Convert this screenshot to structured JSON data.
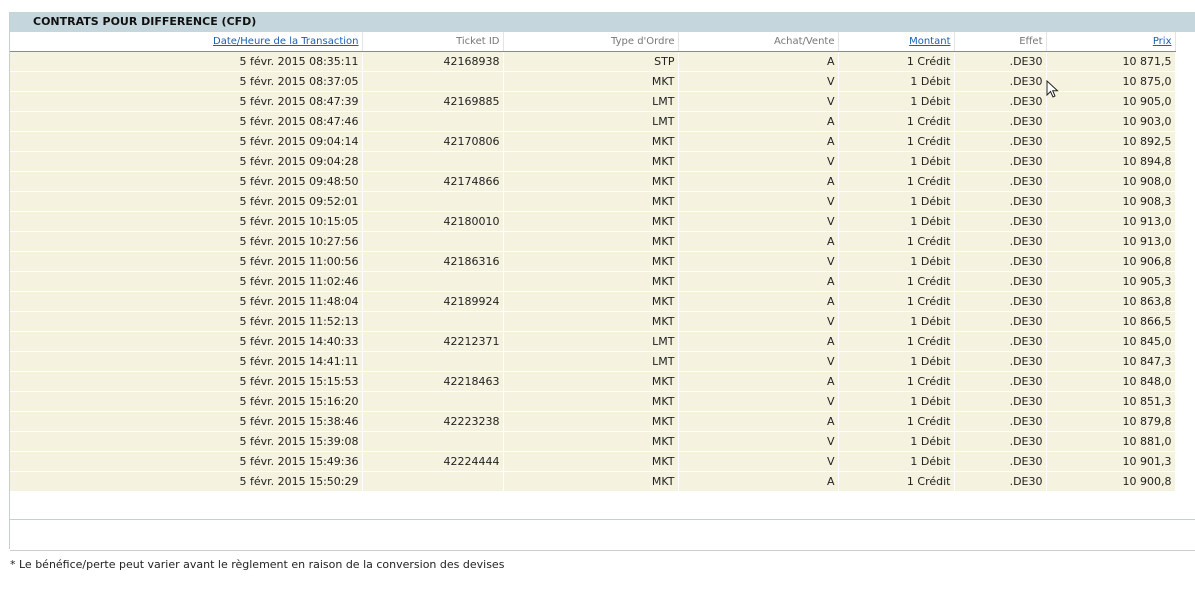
{
  "section": {
    "title": "CONTRATS POUR DIFFERENCE (CFD)"
  },
  "columns": [
    {
      "label": "Date/Heure de la Transaction",
      "sortable": true
    },
    {
      "label": "Ticket ID",
      "sortable": false
    },
    {
      "label": "Type d'Ordre",
      "sortable": false
    },
    {
      "label": "Achat/Vente",
      "sortable": false
    },
    {
      "label": "Montant",
      "sortable": true
    },
    {
      "label": "Effet",
      "sortable": false
    },
    {
      "label": "Prix",
      "sortable": true
    }
  ],
  "rows": [
    [
      "5 févr. 2015 08:35:11",
      "42168938",
      "STP",
      "A",
      "1 Crédit",
      ".DE30",
      "10 871,5"
    ],
    [
      "5 févr. 2015 08:37:05",
      "",
      "MKT",
      "V",
      "1 Débit",
      ".DE30",
      "10 875,0"
    ],
    [
      "5 févr. 2015 08:47:39",
      "42169885",
      "LMT",
      "V",
      "1 Débit",
      ".DE30",
      "10 905,0"
    ],
    [
      "5 févr. 2015 08:47:46",
      "",
      "LMT",
      "A",
      "1 Crédit",
      ".DE30",
      "10 903,0"
    ],
    [
      "5 févr. 2015 09:04:14",
      "42170806",
      "MKT",
      "A",
      "1 Crédit",
      ".DE30",
      "10 892,5"
    ],
    [
      "5 févr. 2015 09:04:28",
      "",
      "MKT",
      "V",
      "1 Débit",
      ".DE30",
      "10 894,8"
    ],
    [
      "5 févr. 2015 09:48:50",
      "42174866",
      "MKT",
      "A",
      "1 Crédit",
      ".DE30",
      "10 908,0"
    ],
    [
      "5 févr. 2015 09:52:01",
      "",
      "MKT",
      "V",
      "1 Débit",
      ".DE30",
      "10 908,3"
    ],
    [
      "5 févr. 2015 10:15:05",
      "42180010",
      "MKT",
      "V",
      "1 Débit",
      ".DE30",
      "10 913,0"
    ],
    [
      "5 févr. 2015 10:27:56",
      "",
      "MKT",
      "A",
      "1 Crédit",
      ".DE30",
      "10 913,0"
    ],
    [
      "5 févr. 2015 11:00:56",
      "42186316",
      "MKT",
      "V",
      "1 Débit",
      ".DE30",
      "10 906,8"
    ],
    [
      "5 févr. 2015 11:02:46",
      "",
      "MKT",
      "A",
      "1 Crédit",
      ".DE30",
      "10 905,3"
    ],
    [
      "5 févr. 2015 11:48:04",
      "42189924",
      "MKT",
      "A",
      "1 Crédit",
      ".DE30",
      "10 863,8"
    ],
    [
      "5 févr. 2015 11:52:13",
      "",
      "MKT",
      "V",
      "1 Débit",
      ".DE30",
      "10 866,5"
    ],
    [
      "5 févr. 2015 14:40:33",
      "42212371",
      "LMT",
      "A",
      "1 Crédit",
      ".DE30",
      "10 845,0"
    ],
    [
      "5 févr. 2015 14:41:11",
      "",
      "LMT",
      "V",
      "1 Débit",
      ".DE30",
      "10 847,3"
    ],
    [
      "5 févr. 2015 15:15:53",
      "42218463",
      "MKT",
      "A",
      "1 Crédit",
      ".DE30",
      "10 848,0"
    ],
    [
      "5 févr. 2015 15:16:20",
      "",
      "MKT",
      "V",
      "1 Débit",
      ".DE30",
      "10 851,3"
    ],
    [
      "5 févr. 2015 15:38:46",
      "42223238",
      "MKT",
      "A",
      "1 Crédit",
      ".DE30",
      "10 879,8"
    ],
    [
      "5 févr. 2015 15:39:08",
      "",
      "MKT",
      "V",
      "1 Débit",
      ".DE30",
      "10 881,0"
    ],
    [
      "5 févr. 2015 15:49:36",
      "42224444",
      "MKT",
      "V",
      "1 Débit",
      ".DE30",
      "10 901,3"
    ],
    [
      "5 févr. 2015 15:50:29",
      "",
      "MKT",
      "A",
      "1 Crédit",
      ".DE30",
      "10 900,8"
    ]
  ],
  "footnote": "* Le bénéfice/perte peut varier avant le règlement en raison de la conversion des devises",
  "colors": {
    "header_bg": "#c5d7dc",
    "row_bg": "#f5f3df",
    "link": "#1a5fb4"
  }
}
